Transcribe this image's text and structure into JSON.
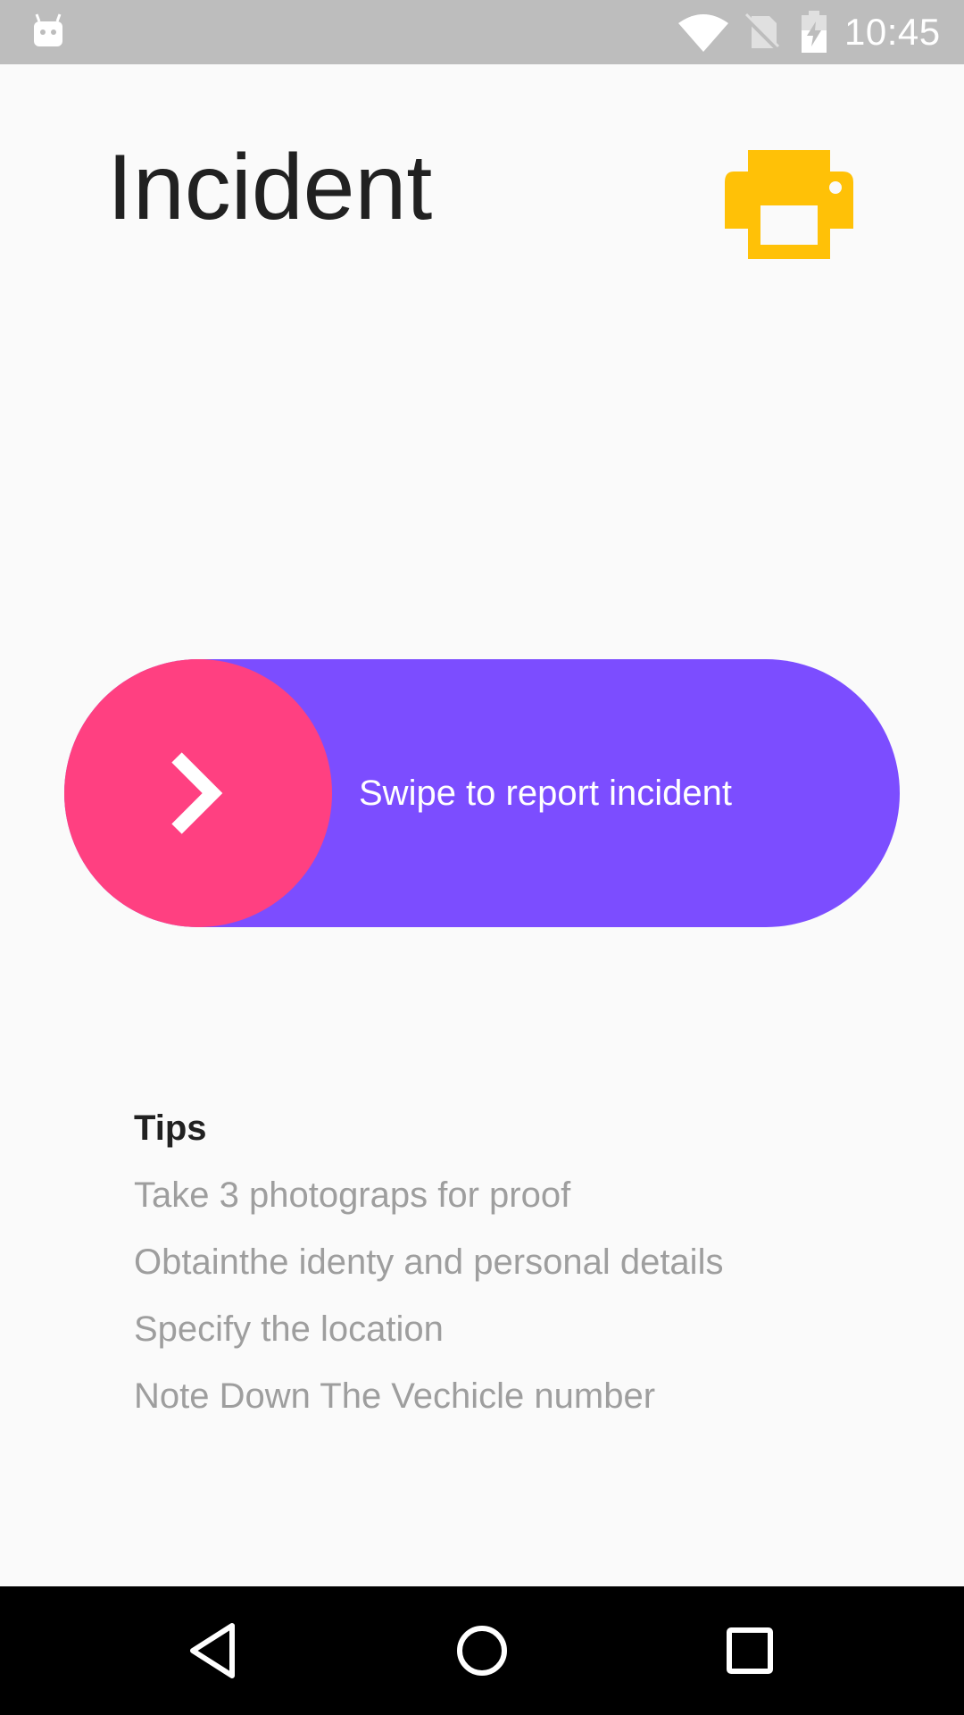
{
  "status_bar": {
    "time": "10:45",
    "icons": [
      "android-icon",
      "wifi-icon",
      "no-sim-icon",
      "battery-charging-icon"
    ]
  },
  "header": {
    "title": "Incident",
    "print_icon": "printer-icon"
  },
  "swipe": {
    "label": "Swipe to report incident",
    "thumb_icon": "chevron-right-icon"
  },
  "tips": {
    "heading": "Tips",
    "items": [
      "Take 3 photograps for proof",
      "Obtainthe identy and personal details",
      "Specify the location",
      "Note Down The Vechicle number"
    ]
  },
  "nav_bar": {
    "icons": [
      "back-icon",
      "home-icon",
      "recents-icon"
    ]
  },
  "colors": {
    "status_bar": "#bdbdbd",
    "background": "#fafafa",
    "accent_yellow": "#ffc107",
    "track_purple": "#7c4dff",
    "thumb_pink": "#ff4081",
    "title_text": "#212121",
    "tip_text": "#9e9e9e",
    "nav_bar": "#000000"
  }
}
